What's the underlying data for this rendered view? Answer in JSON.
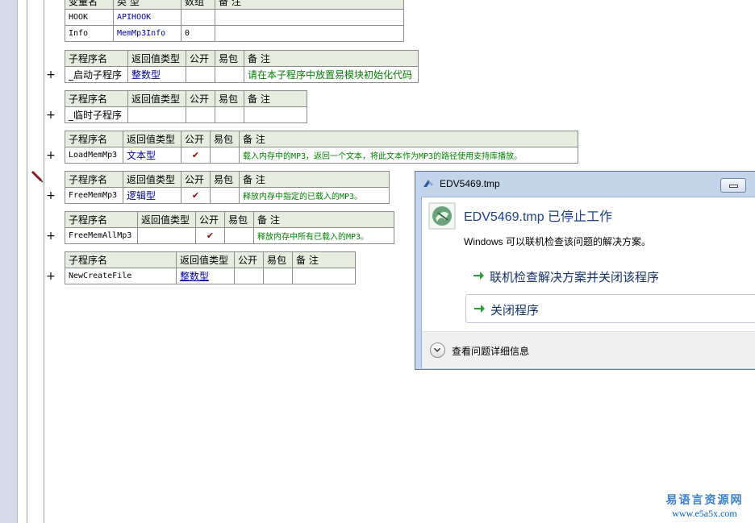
{
  "variables_table": {
    "headers": [
      "变量名",
      "类 型",
      "数组",
      "备 注"
    ],
    "rows": [
      {
        "name": "HOOK",
        "type": "APIHOOK",
        "array": "",
        "remark": ""
      },
      {
        "name": "Info",
        "type": "MemMp3Info",
        "array": "0",
        "remark": ""
      }
    ]
  },
  "subroutine_headers": [
    "子程序名",
    "返回值类型",
    "公开",
    "易包",
    "备 注"
  ],
  "subroutines": [
    {
      "name": "_启动子程序",
      "return_type": "整数型",
      "public": "",
      "easy_pkg": "",
      "remark": "请在本子程序中放置易模块初始化代码"
    },
    {
      "name": "_临时子程序",
      "return_type": "",
      "public": "",
      "easy_pkg": "",
      "remark": ""
    },
    {
      "name": "LoadMemMp3",
      "return_type": "文本型",
      "public": "✔",
      "easy_pkg": "",
      "remark": "载入内存中的MP3，返回一个文本，将此文本作为MP3的路径使用支持库播放。"
    },
    {
      "name": "FreeMemMp3",
      "return_type": "逻辑型",
      "public": "✔",
      "easy_pkg": "",
      "remark": "释放内存中指定的已载入的MP3。"
    },
    {
      "name": "FreeMemAllMp3",
      "return_type": "",
      "public": "✔",
      "easy_pkg": "",
      "remark": "释放内存中所有已载入的MP3。"
    },
    {
      "name": "NewCreateFile",
      "return_type": "整数型",
      "public": "",
      "easy_pkg": "",
      "remark": ""
    }
  ],
  "expand_symbol": "+",
  "dialog": {
    "title": "EDV5469.tmp",
    "heading": "EDV5469.tmp 已停止工作",
    "subtext": "Windows 可以联机检查该问题的解决方案。",
    "option_online": "联机检查解决方案并关闭该程序",
    "option_close": "关闭程序",
    "details": "查看问题详细信息"
  },
  "watermark": {
    "line1": "易语言资源网",
    "line2": "www.e5a5x.com"
  },
  "colors": {
    "header_bg": "#e6eddf",
    "remark_green": "#008000",
    "type_blue": "#0000a0",
    "check_red": "#9a0000",
    "dialog_frame": "#c2d5eb",
    "heading_blue": "#1e3f8a"
  }
}
